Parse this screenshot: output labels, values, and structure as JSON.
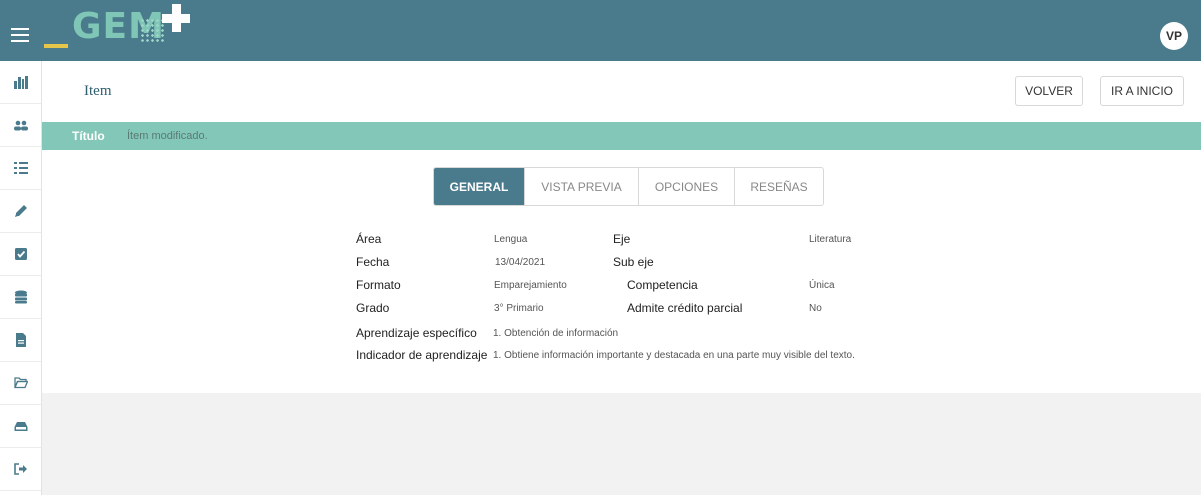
{
  "header": {
    "logo_text": "GEM",
    "avatar_initials": "VP"
  },
  "sidebar": {
    "items": [
      {
        "icon": "institution-icon"
      },
      {
        "icon": "users-icon"
      },
      {
        "icon": "checklist-icon"
      },
      {
        "icon": "pencil-icon"
      },
      {
        "icon": "checkbox-icon"
      },
      {
        "icon": "database-icon"
      },
      {
        "icon": "file-icon"
      },
      {
        "icon": "folder-open-icon"
      },
      {
        "icon": "inbox-icon"
      },
      {
        "icon": "sign-out-icon"
      }
    ]
  },
  "page": {
    "title": "Item",
    "back_label": "VOLVER",
    "home_label": "IR A INICIO"
  },
  "band": {
    "label": "Título",
    "value": "Ítem modificado."
  },
  "tabs": [
    {
      "label": "GENERAL",
      "active": true
    },
    {
      "label": "VISTA PREVIA",
      "active": false
    },
    {
      "label": "OPCIONES",
      "active": false
    },
    {
      "label": "RESEÑAS",
      "active": false
    }
  ],
  "details": {
    "area_label": "Área",
    "area_value": "Lengua",
    "fecha_label": "Fecha",
    "fecha_value": "13/04/2021",
    "formato_label": "Formato",
    "formato_value": "Emparejamiento",
    "grado_label": "Grado",
    "grado_value": "3° Primario",
    "eje_label": "Eje",
    "eje_value": "Literatura",
    "subeje_label": "Sub eje",
    "subeje_value": "",
    "competencia_label": "Competencia",
    "competencia_value": "Única",
    "credito_label": "Admite crédito parcial",
    "credito_value": "No",
    "aprendizaje_label": "Aprendizaje específico",
    "aprendizaje_value": "1. Obtención de información",
    "indicador_label": "Indicador de aprendizaje",
    "indicador_value": "1. Obtiene información importante y destacada en una parte muy visible del texto."
  },
  "colors": {
    "primary": "#4a7b8c",
    "band": "#82c7b8",
    "accent": "#e6c64a"
  }
}
